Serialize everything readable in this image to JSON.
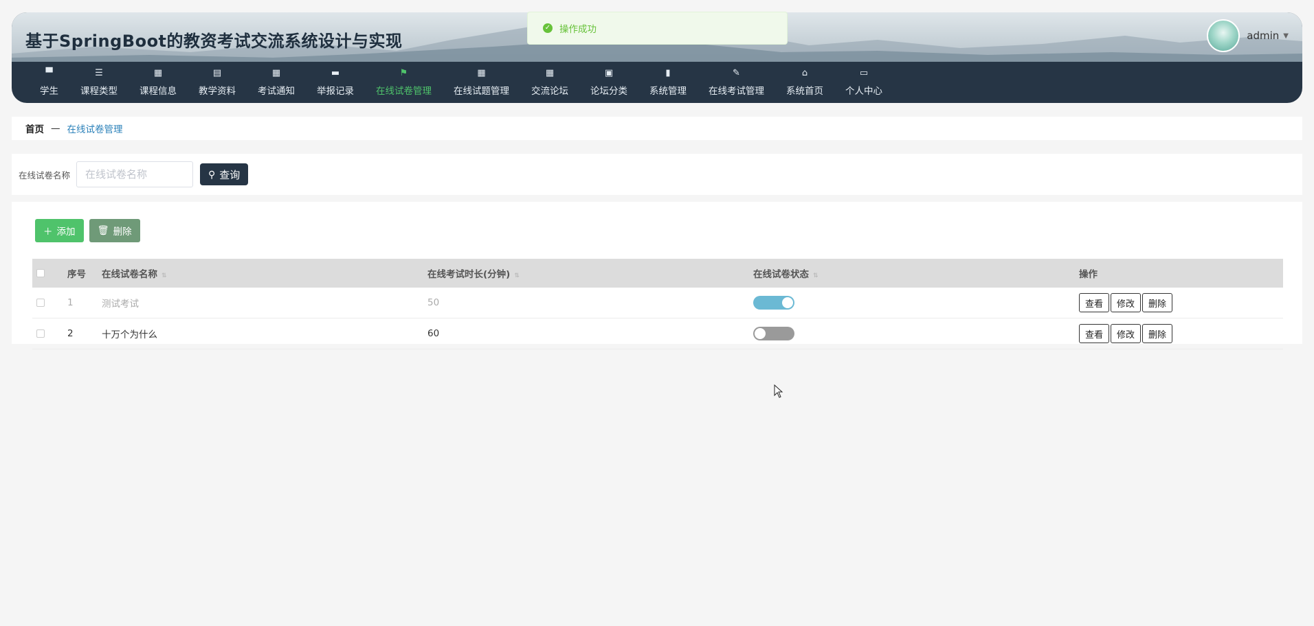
{
  "header": {
    "title": "基于SpringBoot的教资考试交流系统设计与实现",
    "username": "admin"
  },
  "nav": [
    {
      "label": "学生",
      "icon": "▀"
    },
    {
      "label": "课程类型",
      "icon": "☰"
    },
    {
      "label": "课程信息",
      "icon": "▦"
    },
    {
      "label": "教学资料",
      "icon": "▤"
    },
    {
      "label": "考试通知",
      "icon": "▦"
    },
    {
      "label": "举报记录",
      "icon": "▬"
    },
    {
      "label": "在线试卷管理",
      "icon": "⚑"
    },
    {
      "label": "在线试题管理",
      "icon": "▦"
    },
    {
      "label": "交流论坛",
      "icon": "▦"
    },
    {
      "label": "论坛分类",
      "icon": "▣"
    },
    {
      "label": "系统管理",
      "icon": "▮"
    },
    {
      "label": "在线考试管理",
      "icon": "✎"
    },
    {
      "label": "系统首页",
      "icon": "⌂"
    },
    {
      "label": "个人中心",
      "icon": "▭"
    }
  ],
  "active_nav_index": 6,
  "toast": {
    "message": "操作成功"
  },
  "breadcrumb": {
    "home": "首页",
    "separator": "—",
    "current": "在线试卷管理"
  },
  "search": {
    "label": "在线试卷名称",
    "placeholder": "在线试卷名称",
    "value": "",
    "button": "查询"
  },
  "actions": {
    "add": "添加",
    "delete": "删除"
  },
  "table": {
    "columns": [
      "序号",
      "在线试卷名称",
      "在线考试时长(分钟)",
      "在线试卷状态",
      "操作"
    ],
    "rows": [
      {
        "index": "1",
        "name": "测试考试",
        "duration": "50",
        "status_on": true
      },
      {
        "index": "2",
        "name": "十万个为什么",
        "duration": "60",
        "status_on": false
      }
    ],
    "row_actions": {
      "view": "查看",
      "edit": "修改",
      "delete": "删除"
    }
  },
  "colors": {
    "nav_bg": "#263545",
    "active": "#4fc36b",
    "switch_on": "#6bb9d4",
    "switch_off": "#9a9a9a",
    "toast_text": "#67c23a"
  }
}
